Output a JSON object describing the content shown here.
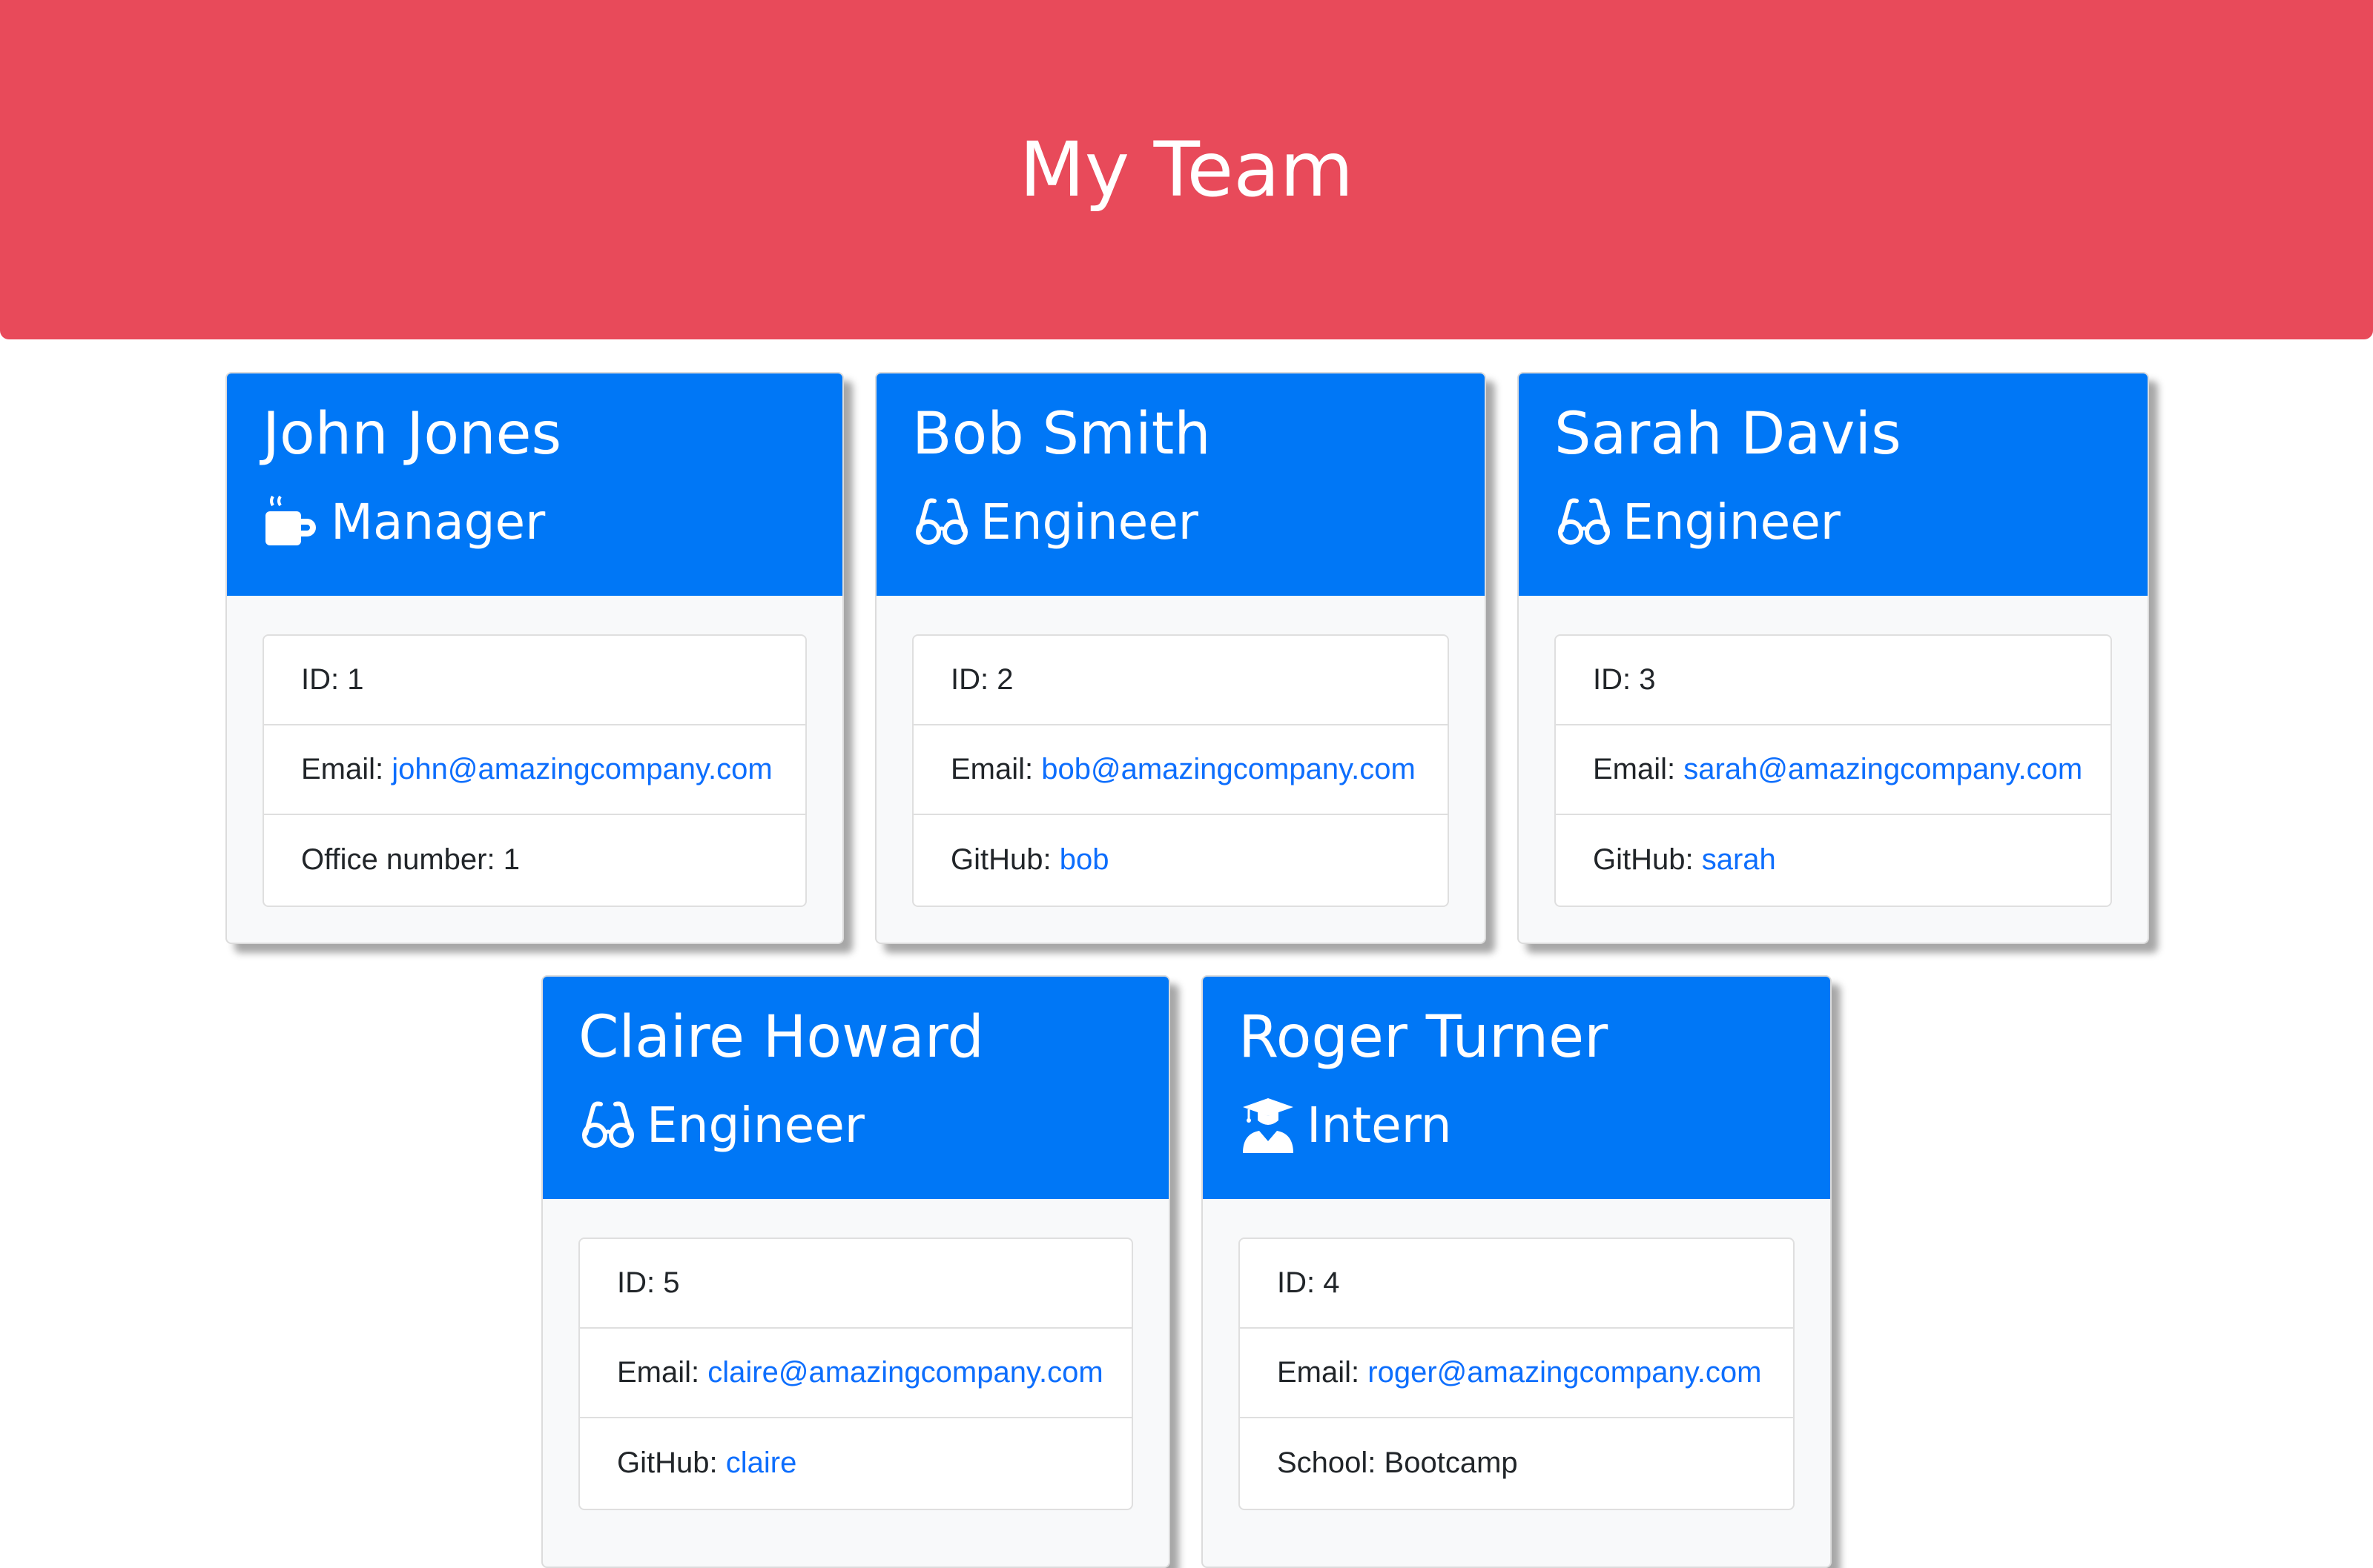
{
  "header": {
    "title": "My Team"
  },
  "colors": {
    "header_bg": "#e84a5a",
    "card_header_bg": "#0077f6",
    "link": "#0d6efd"
  },
  "employees": [
    {
      "name": "John Jones",
      "role": "Manager",
      "icon": "mug-icon",
      "id_label": "ID: 1",
      "email_label": "Email: ",
      "email": "john@amazingcompany.com",
      "extra_label": "Office number: 1",
      "extra_value": ""
    },
    {
      "name": "Bob Smith",
      "role": "Engineer",
      "icon": "glasses-icon",
      "id_label": "ID: 2",
      "email_label": "Email: ",
      "email": "bob@amazingcompany.com",
      "extra_label": "GitHub: ",
      "extra_value": "bob"
    },
    {
      "name": "Sarah Davis",
      "role": "Engineer",
      "icon": "glasses-icon",
      "id_label": "ID: 3",
      "email_label": "Email: ",
      "email": "sarah@amazingcompany.com",
      "extra_label": "GitHub: ",
      "extra_value": "sarah"
    },
    {
      "name": "Claire Howard",
      "role": "Engineer",
      "icon": "glasses-icon",
      "id_label": "ID: 5",
      "email_label": "Email: ",
      "email": "claire@amazingcompany.com",
      "extra_label": "GitHub: ",
      "extra_value": "claire"
    },
    {
      "name": "Roger Turner",
      "role": "Intern",
      "icon": "graduate-icon",
      "id_label": "ID: 4",
      "email_label": "Email: ",
      "email": "roger@amazingcompany.com",
      "extra_label": "School: Bootcamp",
      "extra_value": ""
    }
  ]
}
